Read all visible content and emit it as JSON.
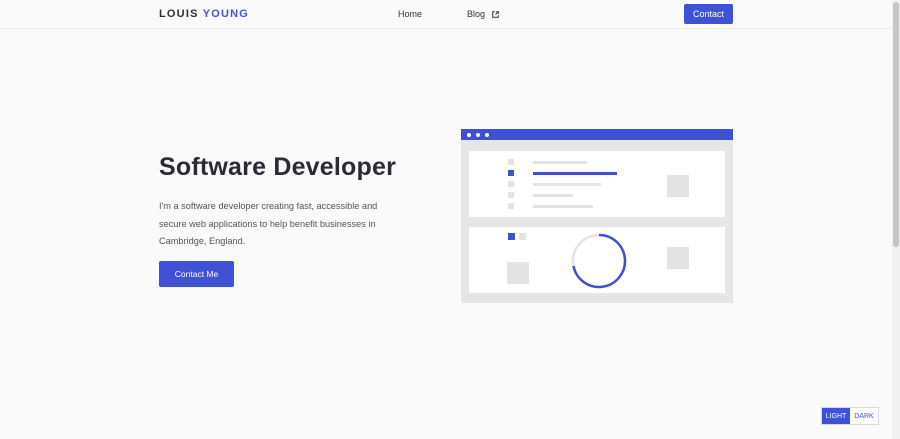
{
  "header": {
    "logo_first": "LOUIS",
    "logo_last": "YOUNG",
    "nav": [
      {
        "label": "Home"
      },
      {
        "label": "Blog",
        "icon": "external-link-icon"
      }
    ],
    "contact_label": "Contact"
  },
  "hero": {
    "title": "Software Developer",
    "description": "I'm a software developer creating fast, accessible and secure web applications to help benefit businesses in Cambridge, England.",
    "cta_label": "Contact Me"
  },
  "theme_toggle": {
    "light_label": "LIGHT",
    "dark_label": "DARK",
    "selected": "LIGHT"
  },
  "colors": {
    "accent": "#3f51d6",
    "background": "#fafafa",
    "illustration_bg": "#e6e6e6"
  }
}
